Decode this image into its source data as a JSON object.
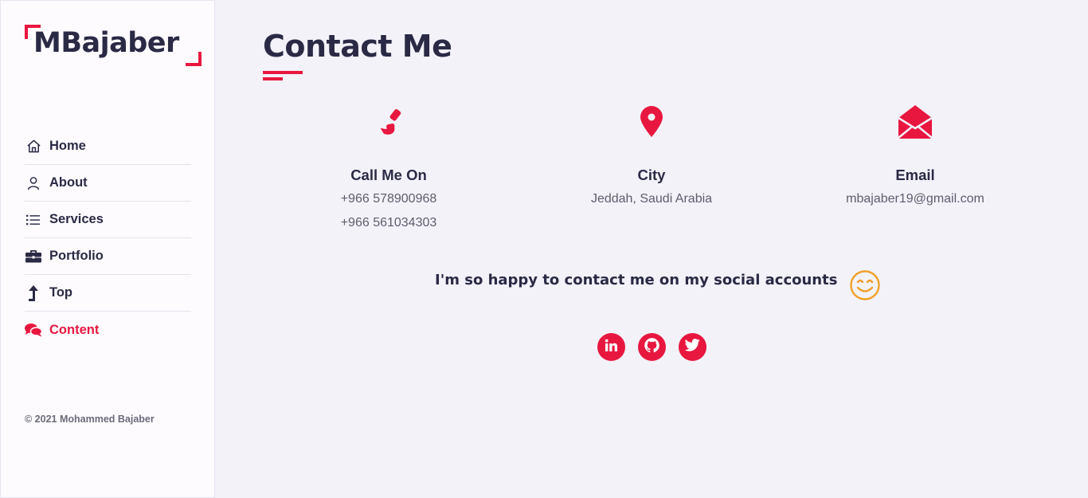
{
  "brand": {
    "logo_text": "MBajaber",
    "accent_color": "#e8173f"
  },
  "sidebar": {
    "items": [
      {
        "label": "Home",
        "icon": "home-icon"
      },
      {
        "label": "About",
        "icon": "user-icon"
      },
      {
        "label": "Services",
        "icon": "list-icon"
      },
      {
        "label": "Portfolio",
        "icon": "briefcase-icon"
      },
      {
        "label": "Top",
        "icon": "arrow-up-icon"
      },
      {
        "label": "Content",
        "icon": "chat-icon",
        "active": true
      }
    ],
    "copyright": "© 2021 Mohammed Bajaber"
  },
  "main": {
    "title": "Contact Me",
    "info": [
      {
        "icon": "phone-icon",
        "title": "Call Me On",
        "lines": [
          "+966 578900968",
          "+966 561034303"
        ]
      },
      {
        "icon": "map-pin-icon",
        "title": "City",
        "lines": [
          "Jeddah, Saudi Arabia"
        ]
      },
      {
        "icon": "envelope-open-icon",
        "title": "Email",
        "lines": [
          "mbajaber19@gmail.com"
        ]
      }
    ],
    "social_text": "I'm so happy to contact me on my social accounts",
    "social_links": [
      {
        "icon": "linkedin-icon"
      },
      {
        "icon": "github-icon"
      },
      {
        "icon": "twitter-icon"
      }
    ]
  }
}
